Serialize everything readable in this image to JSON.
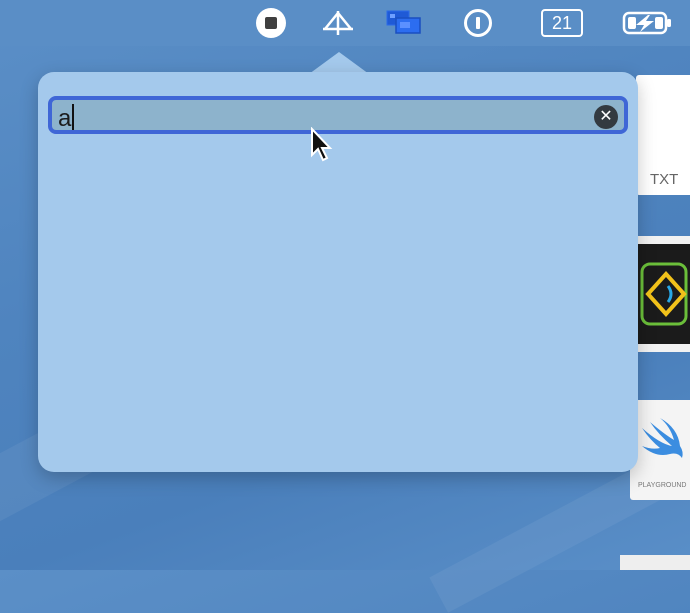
{
  "menubar": {
    "items": [
      {
        "name": "screen-record",
        "icon": "record-stop-icon"
      },
      {
        "name": "antenna",
        "icon": "antenna-icon"
      },
      {
        "name": "screens",
        "icon": "screens-icon"
      },
      {
        "name": "password-manager",
        "icon": "one-password-icon"
      },
      {
        "name": "calendar",
        "icon": "calendar-icon",
        "label": "21"
      },
      {
        "name": "battery",
        "icon": "battery-charging-icon"
      }
    ]
  },
  "popover": {
    "search": {
      "value": "a",
      "clear_icon": "clear-circle-icon"
    }
  },
  "desktop": {
    "files": [
      {
        "name": "txt-file",
        "label": "TXT"
      },
      {
        "name": "code-file",
        "label": ""
      },
      {
        "name": "swift-playground-file",
        "label": "PLAYGROUND"
      }
    ]
  }
}
